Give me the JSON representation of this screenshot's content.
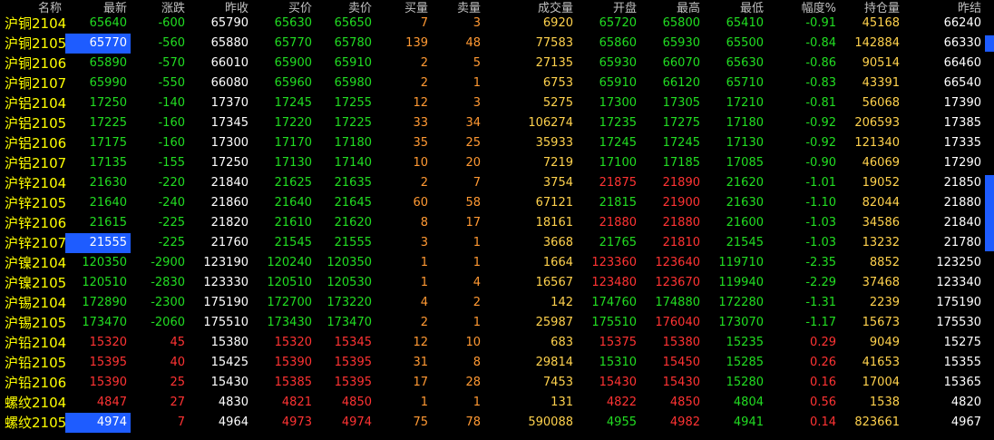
{
  "colors": {
    "background": "#000000",
    "header": "#c0c0c0",
    "name": "#ffff00",
    "up": "#ff3333",
    "down": "#22dd22",
    "neutral": "#ffffff",
    "volume": "#ffd24d",
    "bid_ask_volume": "#ff9933",
    "bid_ask_blue": "#99aaff",
    "highlight": "#1e5cff"
  },
  "columns": [
    "名称",
    "最新",
    "涨跌",
    "昨收",
    "买价",
    "卖价",
    "买量",
    "卖量",
    "成交量",
    "开盘",
    "最高",
    "最低",
    "幅度%",
    "持仓量",
    "昨结"
  ],
  "rows": [
    {
      "name": "沪铜2104",
      "latest": "65640",
      "change": "-600",
      "prev_close": "65790",
      "bid": "65630",
      "ask": "65650",
      "bid_vol": "7",
      "ask_vol": "3",
      "volume": "6920",
      "open": "65720",
      "high": "65800",
      "low": "65410",
      "pct": "-0.91",
      "oi": "45168",
      "prev_settle": "66240",
      "dir": "down",
      "highlight": false
    },
    {
      "name": "沪铜2105",
      "latest": "65770",
      "change": "-560",
      "prev_close": "65880",
      "bid": "65770",
      "ask": "65780",
      "bid_vol": "139",
      "ask_vol": "48",
      "volume": "77583",
      "open": "65860",
      "high": "65930",
      "low": "65500",
      "pct": "-0.84",
      "oi": "142884",
      "prev_settle": "66330",
      "dir": "down",
      "highlight": true
    },
    {
      "name": "沪铜2106",
      "latest": "65890",
      "change": "-570",
      "prev_close": "66010",
      "bid": "65900",
      "ask": "65910",
      "bid_vol": "2",
      "ask_vol": "5",
      "volume": "27135",
      "open": "65930",
      "high": "66070",
      "low": "65630",
      "pct": "-0.86",
      "oi": "90514",
      "prev_settle": "66460",
      "dir": "down",
      "highlight": false
    },
    {
      "name": "沪铜2107",
      "latest": "65990",
      "change": "-550",
      "prev_close": "66080",
      "bid": "65960",
      "ask": "65980",
      "bid_vol": "2",
      "ask_vol": "1",
      "volume": "6753",
      "open": "65910",
      "high": "66120",
      "low": "65710",
      "pct": "-0.83",
      "oi": "43391",
      "prev_settle": "66540",
      "dir": "down",
      "highlight": false
    },
    {
      "name": "沪铝2104",
      "latest": "17250",
      "change": "-140",
      "prev_close": "17370",
      "bid": "17245",
      "ask": "17255",
      "bid_vol": "12",
      "ask_vol": "3",
      "volume": "5275",
      "open": "17300",
      "high": "17305",
      "low": "17210",
      "pct": "-0.81",
      "oi": "56068",
      "prev_settle": "17390",
      "dir": "down",
      "highlight": false
    },
    {
      "name": "沪铝2105",
      "latest": "17225",
      "change": "-160",
      "prev_close": "17345",
      "bid": "17220",
      "ask": "17225",
      "bid_vol": "33",
      "ask_vol": "34",
      "volume": "106274",
      "open": "17235",
      "high": "17275",
      "low": "17180",
      "pct": "-0.92",
      "oi": "206593",
      "prev_settle": "17385",
      "dir": "down",
      "highlight": false
    },
    {
      "name": "沪铝2106",
      "latest": "17175",
      "change": "-160",
      "prev_close": "17300",
      "bid": "17170",
      "ask": "17180",
      "bid_vol": "35",
      "ask_vol": "25",
      "volume": "35933",
      "open": "17245",
      "high": "17245",
      "low": "17130",
      "pct": "-0.92",
      "oi": "121340",
      "prev_settle": "17335",
      "dir": "down",
      "highlight": false
    },
    {
      "name": "沪铝2107",
      "latest": "17135",
      "change": "-155",
      "prev_close": "17250",
      "bid": "17130",
      "ask": "17140",
      "bid_vol": "10",
      "ask_vol": "20",
      "volume": "7219",
      "open": "17100",
      "high": "17185",
      "low": "17085",
      "pct": "-0.90",
      "oi": "46069",
      "prev_settle": "17290",
      "dir": "down",
      "highlight": false
    },
    {
      "name": "沪锌2104",
      "latest": "21630",
      "change": "-220",
      "prev_close": "21840",
      "bid": "21625",
      "ask": "21635",
      "bid_vol": "2",
      "ask_vol": "7",
      "volume": "3754",
      "open": "21875",
      "high": "21890",
      "low": "21620",
      "pct": "-1.01",
      "oi": "19052",
      "prev_settle": "21850",
      "dir": "down",
      "highlight": false
    },
    {
      "name": "沪锌2105",
      "latest": "21640",
      "change": "-240",
      "prev_close": "21860",
      "bid": "21640",
      "ask": "21645",
      "bid_vol": "60",
      "ask_vol": "58",
      "volume": "67121",
      "open": "21815",
      "high": "21900",
      "low": "21630",
      "pct": "-1.10",
      "oi": "82044",
      "prev_settle": "21880",
      "dir": "down",
      "highlight": false
    },
    {
      "name": "沪锌2106",
      "latest": "21615",
      "change": "-225",
      "prev_close": "21820",
      "bid": "21610",
      "ask": "21620",
      "bid_vol": "8",
      "ask_vol": "17",
      "volume": "18161",
      "open": "21880",
      "high": "21880",
      "low": "21600",
      "pct": "-1.03",
      "oi": "34586",
      "prev_settle": "21840",
      "dir": "down",
      "highlight": false
    },
    {
      "name": "沪锌2107",
      "latest": "21555",
      "change": "-225",
      "prev_close": "21760",
      "bid": "21545",
      "ask": "21555",
      "bid_vol": "3",
      "ask_vol": "1",
      "volume": "3668",
      "open": "21765",
      "high": "21810",
      "low": "21545",
      "pct": "-1.03",
      "oi": "13232",
      "prev_settle": "21780",
      "dir": "down",
      "highlight": true
    },
    {
      "name": "沪镍2104",
      "latest": "120350",
      "change": "-2900",
      "prev_close": "123190",
      "bid": "120240",
      "ask": "120350",
      "bid_vol": "1",
      "ask_vol": "1",
      "volume": "1664",
      "open": "123360",
      "high": "123640",
      "low": "119710",
      "pct": "-2.35",
      "oi": "8852",
      "prev_settle": "123250",
      "dir": "down",
      "highlight": false
    },
    {
      "name": "沪镍2105",
      "latest": "120510",
      "change": "-2830",
      "prev_close": "123330",
      "bid": "120510",
      "ask": "120530",
      "bid_vol": "1",
      "ask_vol": "4",
      "volume": "16567",
      "open": "123480",
      "high": "123670",
      "low": "119940",
      "pct": "-2.29",
      "oi": "37468",
      "prev_settle": "123340",
      "dir": "down",
      "highlight": false
    },
    {
      "name": "沪锡2104",
      "latest": "172890",
      "change": "-2300",
      "prev_close": "175190",
      "bid": "172700",
      "ask": "173220",
      "bid_vol": "4",
      "ask_vol": "2",
      "volume": "142",
      "open": "174760",
      "high": "174880",
      "low": "172280",
      "pct": "-1.31",
      "oi": "2239",
      "prev_settle": "175190",
      "dir": "down",
      "highlight": false
    },
    {
      "name": "沪锡2105",
      "latest": "173470",
      "change": "-2060",
      "prev_close": "175510",
      "bid": "173430",
      "ask": "173470",
      "bid_vol": "2",
      "ask_vol": "1",
      "volume": "25987",
      "open": "175510",
      "high": "176040",
      "low": "173070",
      "pct": "-1.17",
      "oi": "15673",
      "prev_settle": "175530",
      "dir": "down",
      "highlight": false
    },
    {
      "name": "沪铅2104",
      "latest": "15320",
      "change": "45",
      "prev_close": "15380",
      "bid": "15320",
      "ask": "15345",
      "bid_vol": "12",
      "ask_vol": "10",
      "volume": "683",
      "open": "15375",
      "high": "15380",
      "low": "15235",
      "pct": "0.29",
      "oi": "9049",
      "prev_settle": "15275",
      "dir": "up",
      "highlight": false
    },
    {
      "name": "沪铅2105",
      "latest": "15395",
      "change": "40",
      "prev_close": "15425",
      "bid": "15390",
      "ask": "15395",
      "bid_vol": "31",
      "ask_vol": "8",
      "volume": "29814",
      "open": "15310",
      "high": "15450",
      "low": "15285",
      "pct": "0.26",
      "oi": "41653",
      "prev_settle": "15355",
      "dir": "up",
      "highlight": false
    },
    {
      "name": "沪铅2106",
      "latest": "15390",
      "change": "25",
      "prev_close": "15430",
      "bid": "15385",
      "ask": "15395",
      "bid_vol": "17",
      "ask_vol": "28",
      "volume": "7453",
      "open": "15430",
      "high": "15430",
      "low": "15280",
      "pct": "0.16",
      "oi": "17004",
      "prev_settle": "15365",
      "dir": "up",
      "highlight": false
    },
    {
      "name": "螺纹2104",
      "latest": "4847",
      "change": "27",
      "prev_close": "4830",
      "bid": "4821",
      "ask": "4850",
      "bid_vol": "1",
      "ask_vol": "1",
      "volume": "131",
      "open": "4822",
      "high": "4850",
      "low": "4804",
      "pct": "0.56",
      "oi": "1538",
      "prev_settle": "4820",
      "dir": "up",
      "highlight": false
    },
    {
      "name": "螺纹2105",
      "latest": "4974",
      "change": "7",
      "prev_close": "4964",
      "bid": "4973",
      "ask": "4974",
      "bid_vol": "75",
      "ask_vol": "78",
      "volume": "590088",
      "open": "4955",
      "high": "4982",
      "low": "4941",
      "pct": "0.14",
      "oi": "823661",
      "prev_settle": "4967",
      "dir": "up",
      "highlight": true
    }
  ]
}
